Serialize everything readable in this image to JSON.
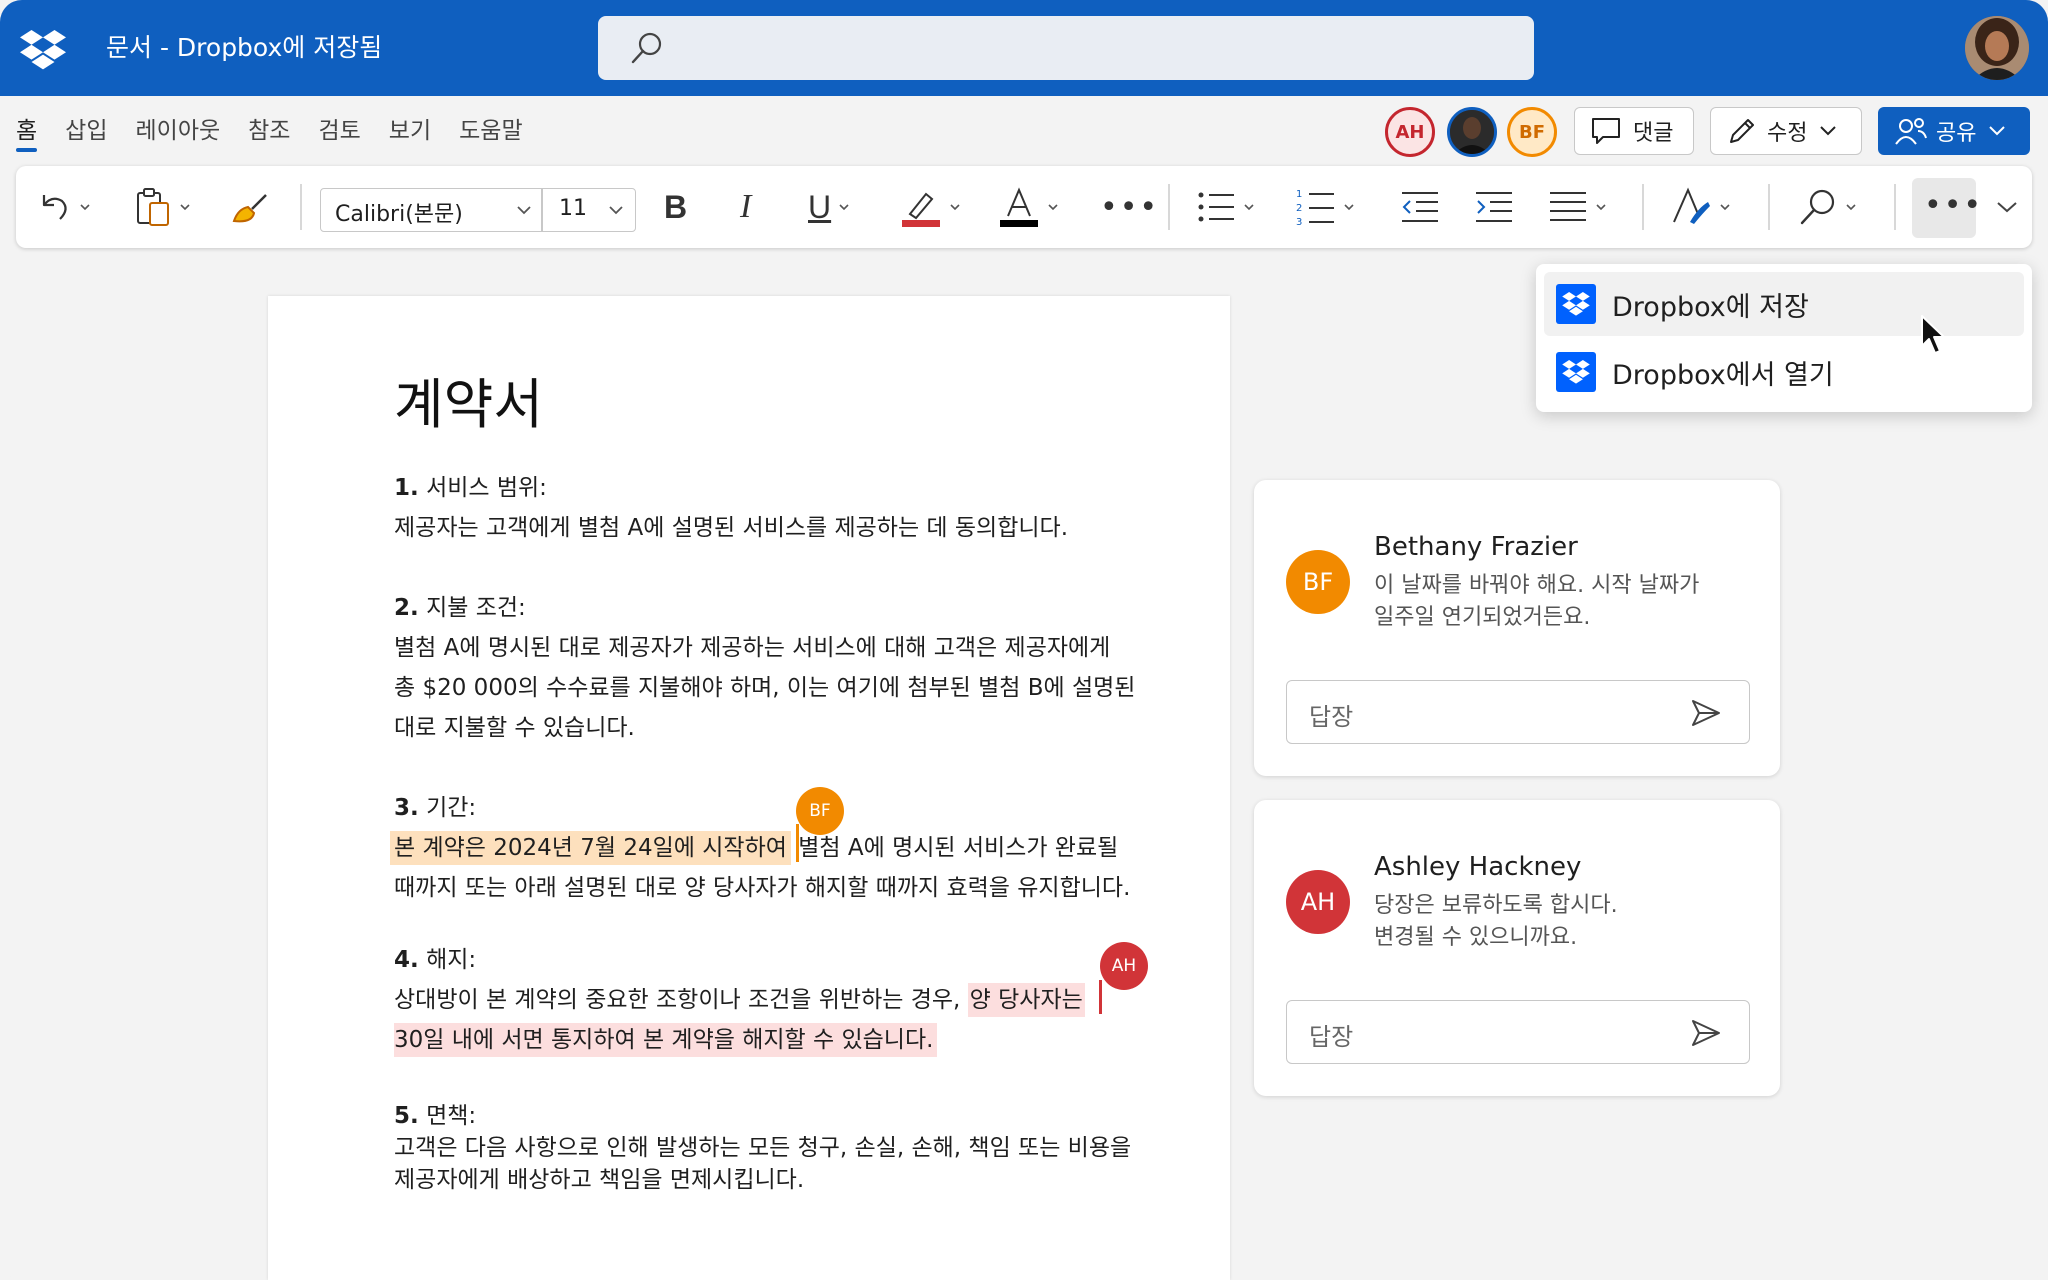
{
  "app": {
    "title": "문서 - Dropbox에 저장됨",
    "brand_color": "#0F5FBF"
  },
  "search": {
    "placeholder": ""
  },
  "tabs": [
    {
      "label": "홈",
      "active": true
    },
    {
      "label": "삽입"
    },
    {
      "label": "레이아웃"
    },
    {
      "label": "참조"
    },
    {
      "label": "검토"
    },
    {
      "label": "보기"
    },
    {
      "label": "도움말"
    }
  ],
  "collaborators": [
    {
      "initials": "AH",
      "color": "#C4262E"
    },
    {
      "initials": "",
      "photo": true
    },
    {
      "initials": "BF",
      "color": "#F28A00"
    }
  ],
  "actions": {
    "comment_label": "댓글",
    "edit_label": "수정",
    "share_label": "공유"
  },
  "toolbar": {
    "font_name": "Calibri(본문)",
    "font_size": "11",
    "icons": [
      "undo-icon",
      "paste-icon",
      "format-painter-icon",
      "bold-icon",
      "italic-icon",
      "underline-icon",
      "highlight-icon",
      "font-color-icon",
      "more-icon",
      "bullets-icon",
      "numbering-icon",
      "decrease-indent-icon",
      "increase-indent-icon",
      "align-icon",
      "styles-icon",
      "find-icon",
      "more-options-icon",
      "collapse-ribbon-icon"
    ],
    "highlight_color": "#D13438",
    "font_color": "#000000"
  },
  "dropdown": {
    "items": [
      {
        "label": "Dropbox에 저장",
        "hover": true
      },
      {
        "label": "Dropbox에서 열기"
      }
    ]
  },
  "document": {
    "title": "계약서",
    "sections": [
      {
        "num": "1.",
        "heading": "서비스 범위:",
        "lines": [
          "제공자는 고객에게 별첨 A에 설명된 서비스를 제공하는 데 동의합니다."
        ]
      },
      {
        "num": "2.",
        "heading": "지불 조건:",
        "lines": [
          "별첨 A에 명시된 대로 제공자가 제공하는 서비스에 대해 고객은 제공자에게",
          "총 $20 000의 수수료를 지불해야 하며, 이는 여기에 첨부된 별첨 B에 설명된",
          "대로 지불할 수 있습니다."
        ]
      },
      {
        "num": "3.",
        "heading": "기간:",
        "highlight": "본 계약은 2024년 7월 24일에 시작하여",
        "rest": "별첨 A에 명시된 서비스가 완료될",
        "lines": [
          "때까지 또는 아래 설명된 대로 양 당사자가 해지할 때까지 효력을 유지합니다."
        ]
      },
      {
        "num": "4.",
        "heading": "해지:",
        "pre": "상대방이 본 계약의 중요한 조항이나 조건을 위반하는 경우,",
        "highlight": "양 당사자는",
        "highlight2": "30일 내에 서면 통지하여 본 계약을 해지할 수 있습니다."
      },
      {
        "num": "5.",
        "heading": "면책:",
        "lines": [
          "고객은 다음 사항으로 인해 발생하는 모든 청구, 손실, 손해, 책임 또는 비용을",
          "제공자에게 배상하고 책임을 면제시킵니다."
        ]
      }
    ]
  },
  "markers": {
    "bf": "BF",
    "ah": "AH"
  },
  "comments": [
    {
      "initials": "BF",
      "color": "#F28A00",
      "name": "Bethany Frazier",
      "lines": [
        "이 날짜를 바꿔야 해요. 시작 날짜가",
        "일주일 연기되었거든요."
      ],
      "reply_placeholder": "답장"
    },
    {
      "initials": "AH",
      "color": "#D13438",
      "name": "Ashley Hackney",
      "lines": [
        "당장은 보류하도록 합시다.",
        "변경될 수 있으니까요."
      ],
      "reply_placeholder": "답장"
    }
  ]
}
